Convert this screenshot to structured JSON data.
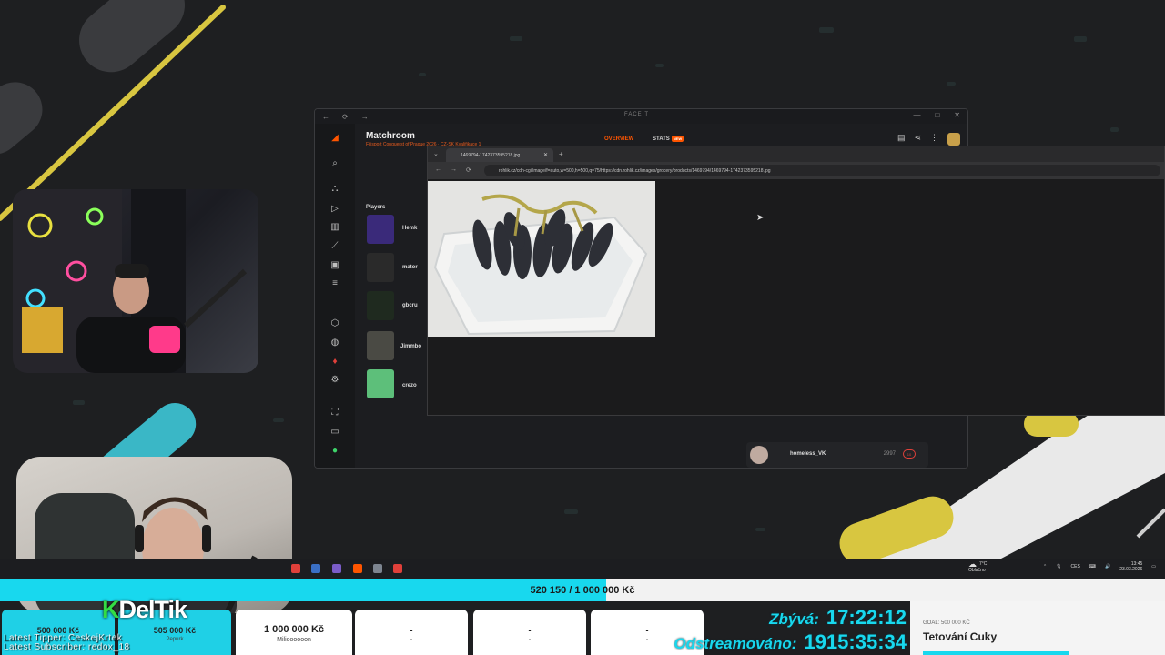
{
  "window": {
    "brand": "FACEIT",
    "app_title": "Matchroom",
    "app_subtitle": "Fijisport Conquerst of Prague 2026 · CZ-SK Kvalifikace 1",
    "tabs": [
      {
        "label": "OVERVIEW",
        "active": true
      },
      {
        "label": "STATS",
        "badge": "NEW"
      }
    ],
    "players_label": "Players",
    "players": [
      {
        "name": "Hemk"
      },
      {
        "name": "mator"
      },
      {
        "name": "gbcru"
      },
      {
        "name": "Jimmbo"
      },
      {
        "name": "crezo"
      }
    ],
    "sub": {
      "name": "homeless_VK",
      "score": "2997",
      "level": "10"
    }
  },
  "viewer": {
    "tab_title": "1469794-1742373595218.jpg",
    "url": "rohlik.cz/cdn-cgi/image/f=auto,w=500,h=500,q=75/https://cdn.rohlik.cz/images/grocery/products/1469794/1469794-1742373595218.jpg"
  },
  "taskbar": {
    "weather_temp": "7°C",
    "weather_desc": "Oblačno",
    "lang": "CES",
    "time": "13:45",
    "date": "23.03.2026"
  },
  "progress": {
    "text": "520 150 / 1 000 000 Kč",
    "fraction": 0.52,
    "accent": "#18d8ee"
  },
  "milestones": [
    {
      "amount": "500 000 Kč",
      "label": "",
      "done": true
    },
    {
      "amount": "505 000 Kč",
      "label": "Pepurk",
      "done": true
    },
    {
      "amount": "1 000 000 Kč",
      "label": "Milioooooon",
      "done": false
    },
    {
      "amount": "-",
      "label": "-",
      "done": false
    },
    {
      "amount": "-",
      "label": "-",
      "done": false
    },
    {
      "amount": "-",
      "label": "-",
      "done": false
    }
  ],
  "timers": {
    "remaining_label": "Zbývá:",
    "remaining": "17:22:12",
    "streamed_label": "Odstreamováno:",
    "streamed": "1915:35:34"
  },
  "goal": {
    "label": "GOAL: 500 000 KČ",
    "title": "Tetování Cuky"
  },
  "overlay": {
    "logo_k": "K",
    "logo_text": "DelTik",
    "latest_tipper": "Latest Tipper: CeskejKrtek",
    "latest_subscriber": "Latest Subscriber: redox_18"
  }
}
